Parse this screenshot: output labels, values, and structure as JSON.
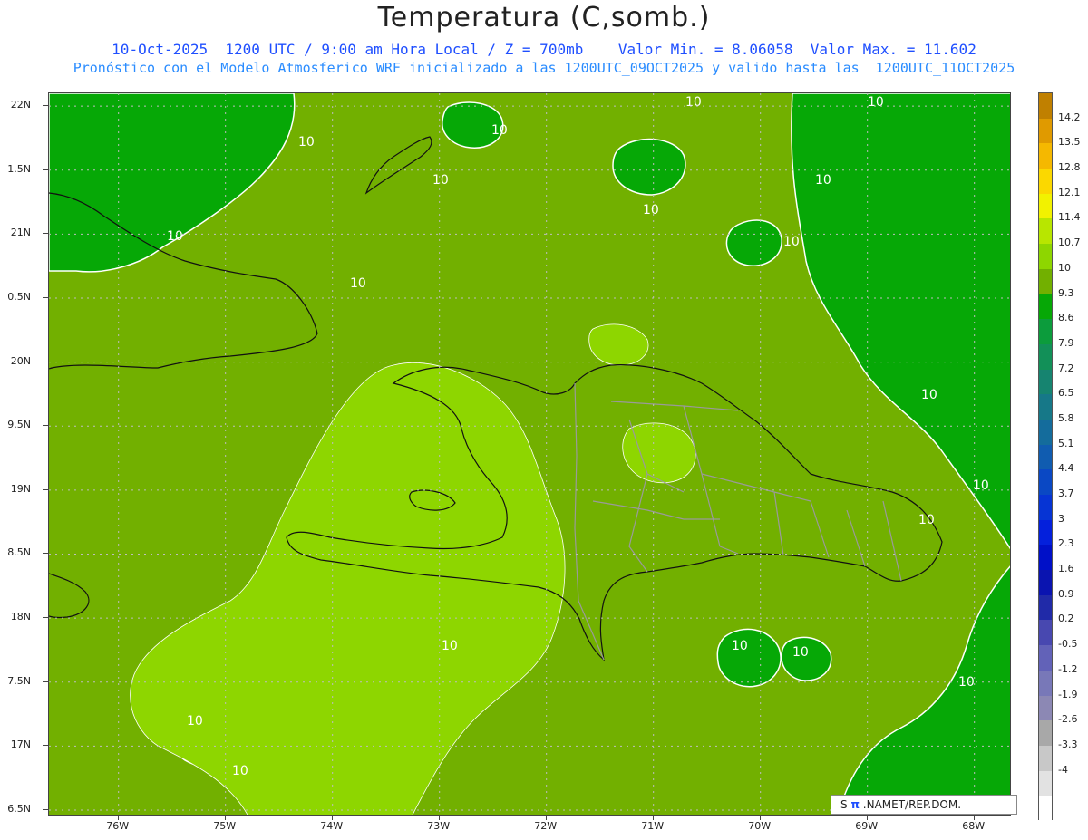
{
  "header": {
    "title": "Temperatura (C,somb.)",
    "line1": "10-Oct-2025  1200 UTC / 9:00 am Hora Local / Z = 700mb    Valor Min. = 8.06058  Valor Max. = 11.602",
    "line2": "Pronóstico con el Modelo Atmosferico WRF inicializado a las 1200UTC_09OCT2025 y valido hasta las  1200UTC_11OCT2025"
  },
  "axes": {
    "lat_labels": [
      "22N",
      "1.5N",
      "21N",
      "0.5N",
      "20N",
      "9.5N",
      "19N",
      "8.5N",
      "18N",
      "7.5N",
      "17N",
      "6.5N"
    ],
    "lat_values": [
      22,
      21.5,
      21,
      20.5,
      20,
      19.5,
      19,
      18.5,
      18,
      17.5,
      17,
      16.5
    ],
    "lon_labels": [
      "76W",
      "75W",
      "74W",
      "73W",
      "72W",
      "71W",
      "70W",
      "69W",
      "68W"
    ],
    "lon_values": [
      -76,
      -75,
      -74,
      -73,
      -72,
      -71,
      -70,
      -69,
      -68
    ],
    "lat_range": [
      16.45,
      22.1
    ],
    "lon_range": [
      -76.65,
      -67.65
    ]
  },
  "colorbar": {
    "labels": [
      "14.2",
      "13.5",
      "12.8",
      "12.1",
      "11.4",
      "10.7",
      "10",
      "9.3",
      "8.6",
      "7.9",
      "7.2",
      "6.5",
      "5.8",
      "5.1",
      "4.4",
      "3.7",
      "3",
      "2.3",
      "1.6",
      "0.9",
      "0.2",
      "-0.5",
      "-1.2",
      "-1.9",
      "-2.6",
      "-3.3",
      "-4"
    ],
    "colors": [
      "#c08000",
      "#e09a00",
      "#f5b800",
      "#fbd800",
      "#f2f200",
      "#b8e600",
      "#8ed600",
      "#72b000",
      "#06a806",
      "#0c9c3c",
      "#129058",
      "#168470",
      "#167888",
      "#146c9c",
      "#105cb0",
      "#0a48c4",
      "#0634d4",
      "#0420dc",
      "#0010c8",
      "#0a14b0",
      "#202aa8",
      "#4848b0",
      "#6262b8",
      "#7878b8",
      "#8c88b4",
      "#a8a8a8",
      "#c8c8c8",
      "#e2e2e2",
      "#ffffff"
    ]
  },
  "map_colors": {
    "cool_green": "#06a806",
    "mid_green": "#72b000",
    "warm_green": "#8ed600",
    "contour": "#ffffff",
    "coast": "#111111",
    "borders": "#9a9a9a",
    "grid": "#bdbdbd"
  },
  "contour_label": "10",
  "credit": {
    "prefix": "S",
    "glyph": "π",
    "text": " .NAMET/REP.DOM."
  }
}
